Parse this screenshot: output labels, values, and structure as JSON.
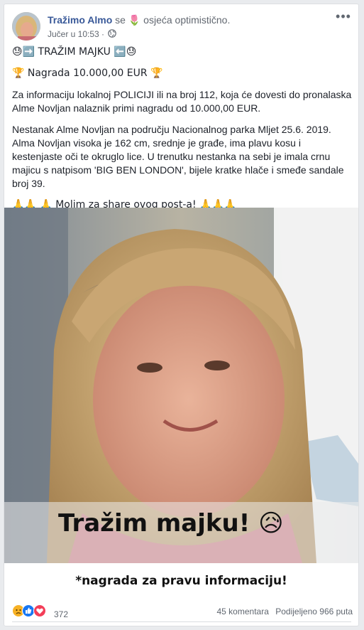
{
  "post": {
    "author": "Tražimo Almo",
    "verb_pre": " se ",
    "feeling_emoji": "🌷",
    "feeling_text": " osjeća optimistično.",
    "timestamp": "Jučer u 10:53 ·",
    "more_label": "•••"
  },
  "content": {
    "line1": "😓➡️ TRAŽIM MAJKU ⬅️😓",
    "line2": "🏆 Nagrada 10.000,00 EUR 🏆",
    "paragraph1": "Za informaciju lokalnoj POLICIJI ili na broj 112, koja će dovesti do pronalaska Alme Novljan nalaznik primi nagradu od 10.000,00 EUR.",
    "paragraph2": "Nestanak Alme Novljan na području Nacionalnog parka Mljet 25.6. 2019. Alma Novljan visoka je 162 cm, srednje je građe, ima plavu kosu i kestenjaste oči te okruglo lice. U trenutku nestanka na sebi je imala crnu majicu s natpisom 'BIG BEN LONDON', bijele kratke hlače i smeđe sandale broj 39.",
    "paragraph3": "🙏🙏 🙏 Molim za share ovog post-a! 🙏🙏🙏"
  },
  "image": {
    "caption": "Tražim majku!",
    "caption_emoji": "😥",
    "footer": "*nagrada za pravu informaciju!"
  },
  "stats": {
    "reactions_count": "372",
    "comments": "45 komentara",
    "shares": "Podijeljeno 966 puta",
    "reaction_types": [
      "sad",
      "like",
      "love"
    ]
  },
  "colors": {
    "link_blue": "#385898",
    "like_blue": "#1877f2",
    "love_red": "#f33e58",
    "sad_yellow": "#f7b125"
  }
}
